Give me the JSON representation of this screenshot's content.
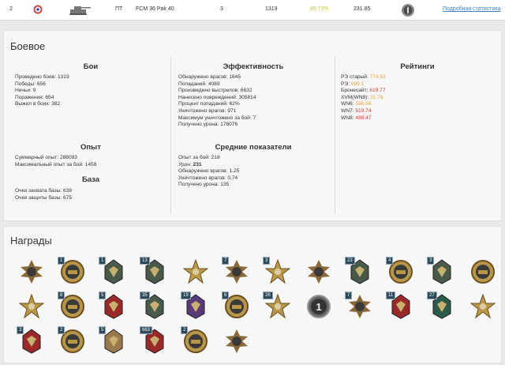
{
  "vehicle_row": {
    "rank": "2",
    "icon_nation": "france-roundel-icon",
    "icon_tank": "tank-silhouette-icon",
    "class": "ПТ",
    "name": "FCM 36 Pak 40",
    "tier": "3",
    "battles": "1319",
    "winrate": "49.73%",
    "value": "231.85",
    "mastery_icon": "mastery-badge-icon",
    "details_link": "Подробная статистика"
  },
  "combat": {
    "title": "Боевое",
    "battles": {
      "heading": "Бои",
      "items": [
        "Проведено боев: 1319",
        "Победы: 656",
        "Ничьи: 9",
        "Поражения: 654",
        "Выжил в боях: 382"
      ]
    },
    "efficiency": {
      "heading": "Эффективность",
      "items": [
        "Обнаружено врагов: 1645",
        "Попаданий: 4089",
        "Произведено выстрелов: 6632",
        "Нанесено повреждений: 305814",
        "Процент попаданий: 62%",
        "Уничтожено врагов: 971",
        "Максимум уничтожено за бой: 7",
        "Получено урона: 178076"
      ]
    },
    "ratings": {
      "heading": "Рейтинги",
      "items": [
        {
          "label": "РЭ старый:",
          "value": "774.53",
          "color": "#e8a23a"
        },
        {
          "label": "РЭ:",
          "value": "690.1",
          "color": "#e8a23a"
        },
        {
          "label": "Бронесайт:",
          "value": "619.77",
          "color": "#e0392b"
        },
        {
          "label": "XVM(WN8):",
          "value": "21.76",
          "color": "#e8a23a"
        },
        {
          "label": "WN6:",
          "value": "586.86",
          "color": "#e8a23a"
        },
        {
          "label": "WN7:",
          "value": "519.74",
          "color": "#e0392b"
        },
        {
          "label": "WN8:",
          "value": "488.47",
          "color": "#e0392b"
        }
      ]
    },
    "experience": {
      "heading": "Опыт",
      "items": [
        "Суммарный опыт: 288093",
        "Максимальный опыт за бой: 1458"
      ]
    },
    "base": {
      "heading": "База",
      "items": [
        "Очки захвата базы: 638",
        "Очки защиты базы: 675"
      ]
    },
    "averages": {
      "heading": "Средние показатели",
      "items": [
        {
          "label": "Опыт за бой:",
          "value": "218",
          "bold": false
        },
        {
          "label": "Урон:",
          "value": "231",
          "bold": true
        },
        {
          "label": "Обнаружено врагов:",
          "value": "1.25",
          "bold": false
        },
        {
          "label": "Уничтожено врагов:",
          "value": "0.74",
          "bold": false
        },
        {
          "label": "Получено урона:",
          "value": "135",
          "bold": false
        }
      ]
    }
  },
  "awards": {
    "title": "Награды",
    "rows": [
      [
        {
          "icon": "cross-medal-icon",
          "count": ""
        },
        {
          "icon": "tank-medal-icon",
          "count": "1"
        },
        {
          "icon": "rank-chevron-badge-icon",
          "count": "1"
        },
        {
          "icon": "soldier-badge-icon",
          "count": "13"
        },
        {
          "icon": "star-medal-icon",
          "count": ""
        },
        {
          "icon": "crossed-rifles-badge-icon",
          "count": "7"
        },
        {
          "icon": "shield-red-star-badge-icon",
          "count": "3"
        },
        {
          "icon": "cross-portrait-medal-icon",
          "count": ""
        },
        {
          "icon": "diamond-badge-icon",
          "count": "23"
        },
        {
          "icon": "tank-wreath-medal-icon",
          "count": "4"
        },
        {
          "icon": "sword-badge-icon",
          "count": "3"
        },
        {
          "icon": "portrait-hexagon-medal-icon",
          "count": ""
        }
      ],
      [
        {
          "icon": "star-bronze-medal-icon",
          "count": ""
        },
        {
          "icon": "gold-tank-medal-icon",
          "count": "8"
        },
        {
          "icon": "red-cape-badge-icon",
          "count": "5"
        },
        {
          "icon": "diamond-gold-badge-icon",
          "count": "35"
        },
        {
          "icon": "purple-scroll-badge-icon",
          "count": "19"
        },
        {
          "icon": "wot-logo-medal-icon",
          "count": "6"
        },
        {
          "icon": "plane-star-medal-icon",
          "count": "26"
        },
        {
          "icon": "mastery-one-medal-icon",
          "count": ""
        },
        {
          "icon": "tank-cross-medal-icon",
          "count": "7"
        },
        {
          "icon": "diamond-red-badge-icon",
          "count": "11"
        },
        {
          "icon": "green-sword-badge-icon",
          "count": "27"
        },
        {
          "icon": "star-portrait-medal-icon",
          "count": ""
        }
      ],
      [
        {
          "icon": "blue-red-badge-icon",
          "count": "3"
        },
        {
          "icon": "wreath-tank-medal-icon",
          "count": "2"
        },
        {
          "icon": "tan-book-badge-icon",
          "count": "5"
        },
        {
          "icon": "soldier-red-badge-icon",
          "count": "663"
        },
        {
          "icon": "gear-sun-medal-icon",
          "count": "2"
        },
        {
          "icon": "bronze-cross-medal-icon",
          "count": ""
        }
      ]
    ]
  },
  "colors": {
    "winrate": "#c8c832",
    "link": "#3b84c4",
    "page_bg": "#e9e9e9",
    "panel_bg": "#f7f7f7"
  }
}
